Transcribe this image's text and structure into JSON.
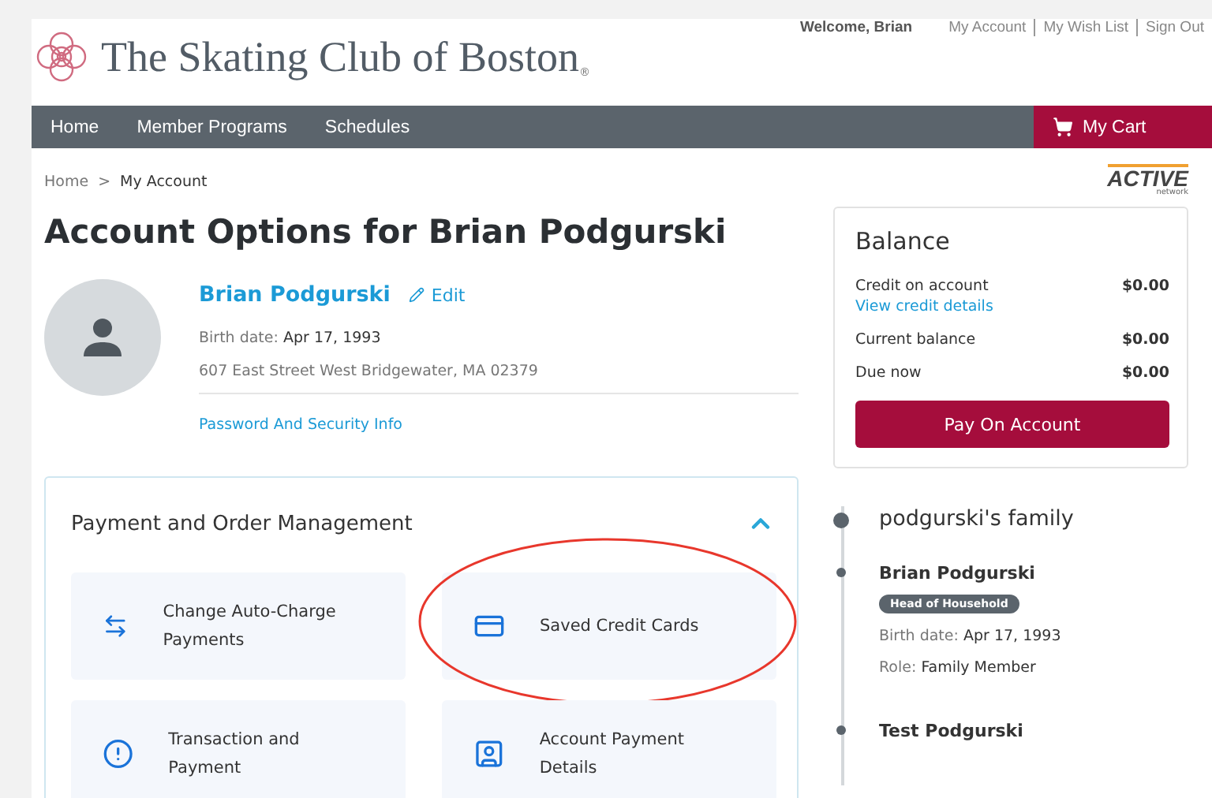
{
  "header": {
    "site_title": "The Skating Club of Boston",
    "registered_mark": "®",
    "welcome": "Welcome, Brian",
    "links": [
      "My Account",
      "My Wish List",
      "Sign Out"
    ]
  },
  "nav": {
    "items": [
      "Home",
      "Member Programs",
      "Schedules"
    ],
    "cart": "My Cart"
  },
  "breadcrumb": {
    "items": [
      "Home",
      "My Account"
    ],
    "separator": ">"
  },
  "partner_logo": {
    "name": "ACTIVE",
    "sub": "network"
  },
  "heading": "Account Options for Brian Podgurski",
  "profile": {
    "name": "Brian Podgurski",
    "edit": "Edit",
    "birth_label": "Birth date:",
    "birth_value": "Apr 17, 1993",
    "address": "607 East Street West Bridgewater, MA 02379",
    "security_link": "Password And Security Info"
  },
  "balance": {
    "title": "Balance",
    "rows": [
      {
        "label": "Credit on account",
        "value": "$0.00",
        "link": "View credit details"
      },
      {
        "label": "Current balance",
        "value": "$0.00"
      },
      {
        "label": "Due now",
        "value": "$0.00"
      }
    ],
    "button": "Pay On Account"
  },
  "payment_card": {
    "title": "Payment and Order Management",
    "expanded": true,
    "tiles": [
      {
        "kind": "autocharge",
        "label": "Change Auto-Charge Payments",
        "circled": false
      },
      {
        "kind": "cards",
        "label": "Saved Credit Cards",
        "circled": true
      },
      {
        "kind": "history",
        "label": "Transaction and Payment",
        "circled": false
      },
      {
        "kind": "account",
        "label": "Account Payment Details",
        "circled": false
      }
    ]
  },
  "family": {
    "title": "podgurski's family",
    "members": [
      {
        "name": "Brian Podgurski",
        "badge": "Head of Household",
        "birth_label": "Birth date:",
        "birth_value": "Apr 17, 1993",
        "role_label": "Role:",
        "role_value": "Family Member"
      },
      {
        "name": "Test Podgurski"
      }
    ]
  }
}
